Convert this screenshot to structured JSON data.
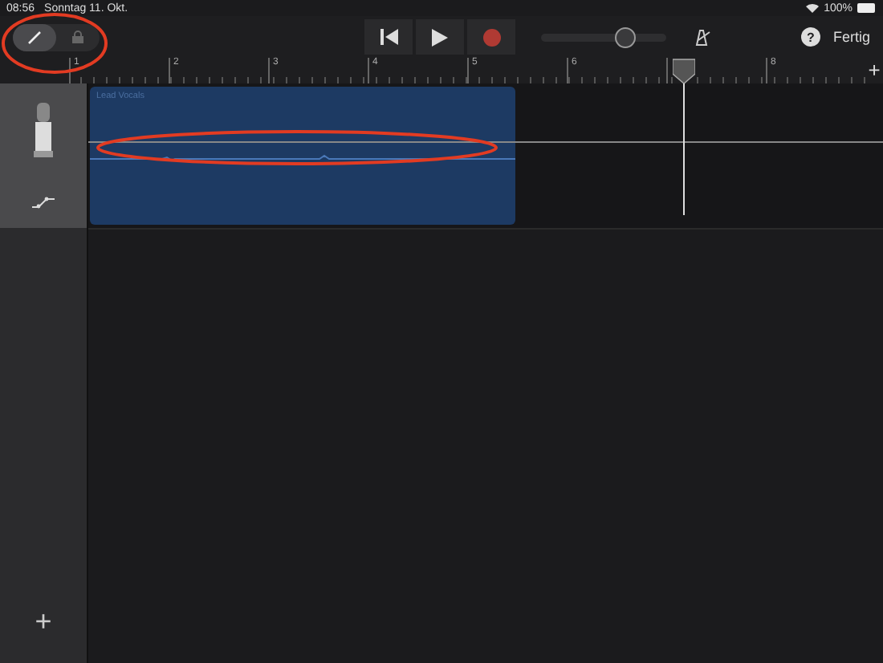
{
  "status_bar": {
    "time": "08:56",
    "date": "Sonntag 11. Okt.",
    "battery": "100%"
  },
  "toolbar": {
    "mode_toggle": [
      {
        "kind": "pencil",
        "selected": true
      },
      {
        "kind": "lock",
        "selected": false
      }
    ],
    "volume": {
      "level": 0.67
    },
    "done": "Fertig",
    "help": "?"
  },
  "ruler": {
    "bars": [
      {
        "kind": "number",
        "label": "1"
      },
      {
        "kind": "number",
        "label": "2"
      },
      {
        "kind": "number",
        "label": "3"
      },
      {
        "kind": "number",
        "label": "4"
      },
      {
        "kind": "number",
        "label": "5"
      },
      {
        "kind": "number",
        "label": "6"
      },
      {
        "kind": "playhead"
      },
      {
        "kind": "number",
        "label": "8"
      }
    ],
    "add": "+"
  },
  "tracks": [
    {
      "kind": "microphone",
      "region": {
        "name": "Lead Vocals"
      }
    }
  ],
  "sidebar": {
    "add": "+"
  }
}
